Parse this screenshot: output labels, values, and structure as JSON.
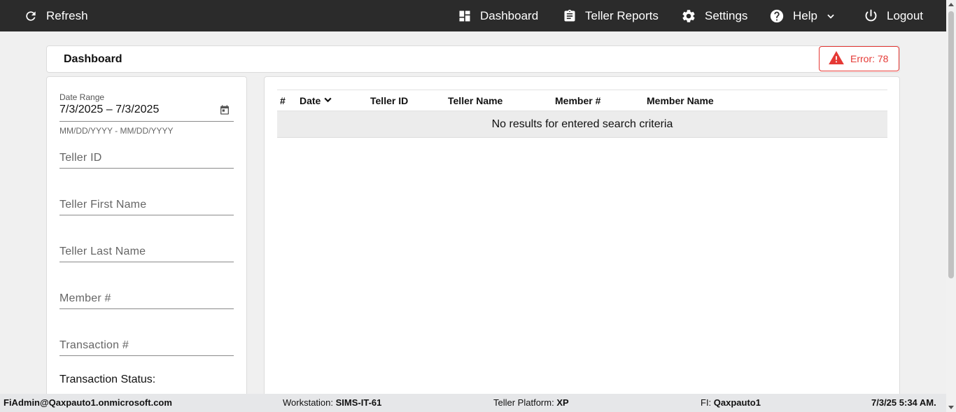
{
  "topbar": {
    "refresh_label": "Refresh",
    "dashboard_label": "Dashboard",
    "teller_reports_label": "Teller Reports",
    "settings_label": "Settings",
    "help_label": "Help",
    "logout_label": "Logout",
    "background": "#2b2b2b"
  },
  "header": {
    "title": "Dashboard",
    "error_label": "Error: 78",
    "error_color": "#e53935"
  },
  "filters": {
    "date_range_label": "Date Range",
    "date_range_value": "7/3/2025 – 7/3/2025",
    "date_range_hint": "MM/DD/YYYY - MM/DD/YYYY",
    "teller_id_placeholder": "Teller ID",
    "teller_first_name_placeholder": "Teller First Name",
    "teller_last_name_placeholder": "Teller Last Name",
    "member_placeholder": "Member #",
    "transaction_placeholder": "Transaction #",
    "transaction_status_label": "Transaction Status:"
  },
  "table": {
    "columns": [
      "#",
      "Date",
      "Teller ID",
      "Teller Name",
      "Member #",
      "Member Name"
    ],
    "empty_message": "No results for entered search criteria"
  },
  "statusbar": {
    "user": "FiAdmin@Qaxpauto1.onmicrosoft.com",
    "workstation_label": "Workstation:",
    "workstation_value": "SIMS-IT-61",
    "platform_label": "Teller Platform:",
    "platform_value": "XP",
    "fi_label": "FI:",
    "fi_value": "Qaxpauto1",
    "datetime": "7/3/25 5:34 AM."
  }
}
